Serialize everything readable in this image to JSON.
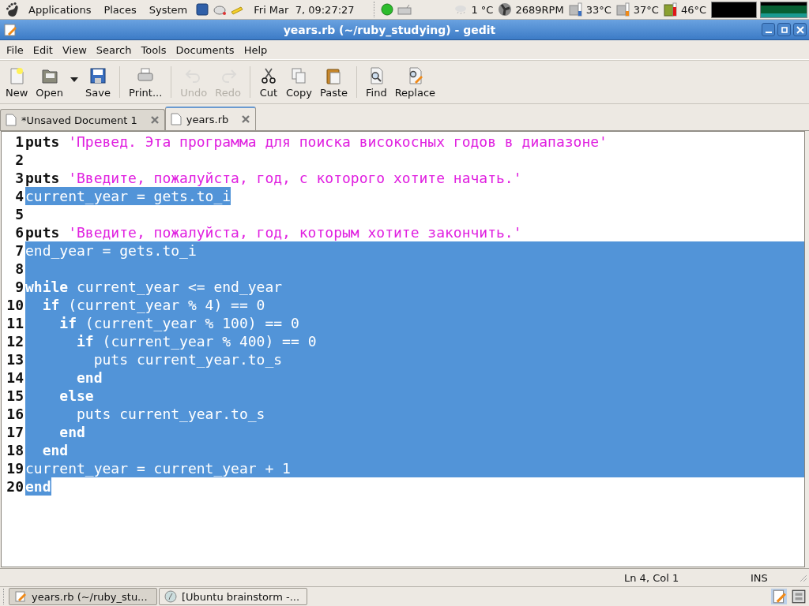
{
  "top_panel": {
    "menus": [
      "Applications",
      "Places",
      "System"
    ],
    "clock": "Fri Mar  7, 09:27:27",
    "sensors": [
      {
        "kind": "weather",
        "reading": "1 °C"
      },
      {
        "kind": "fan",
        "reading": "2689RPM"
      },
      {
        "kind": "thermo",
        "reading": "33°C",
        "color": "#3a6fc0"
      },
      {
        "kind": "thermo",
        "reading": "37°C",
        "color": "#f08a18"
      },
      {
        "kind": "card",
        "reading": "46°C",
        "color": "#e01818"
      }
    ]
  },
  "window": {
    "title": "years.rb (~/ruby_studying) - gedit"
  },
  "menu": [
    "File",
    "Edit",
    "View",
    "Search",
    "Tools",
    "Documents",
    "Help"
  ],
  "toolbar": [
    {
      "kind": "new",
      "label": "New",
      "disabled": false
    },
    {
      "kind": "open",
      "label": "Open",
      "disabled": false
    },
    {
      "kind": "dropdown"
    },
    {
      "kind": "save",
      "label": "Save",
      "disabled": false
    },
    {
      "kind": "separator"
    },
    {
      "kind": "print",
      "label": "Print...",
      "disabled": false
    },
    {
      "kind": "separator"
    },
    {
      "kind": "undo",
      "label": "Undo",
      "disabled": true
    },
    {
      "kind": "redo",
      "label": "Redo",
      "disabled": true
    },
    {
      "kind": "separator"
    },
    {
      "kind": "cut",
      "label": "Cut",
      "disabled": false
    },
    {
      "kind": "copy",
      "label": "Copy",
      "disabled": false
    },
    {
      "kind": "paste",
      "label": "Paste",
      "disabled": false
    },
    {
      "kind": "separator"
    },
    {
      "kind": "find",
      "label": "Find",
      "disabled": false
    },
    {
      "kind": "replace",
      "label": "Replace",
      "disabled": false
    }
  ],
  "tabs": [
    {
      "label": "*Unsaved Document 1",
      "selected": false
    },
    {
      "label": "years.rb",
      "selected": true
    }
  ],
  "editor": {
    "lines": [
      {
        "number": "1",
        "selected": false,
        "tokens": [
          {
            "kind": "keyword",
            "text": "puts "
          },
          {
            "kind": "string",
            "text": "'Превед. Эта программа для поиска високосных годов в диапазоне'"
          }
        ]
      },
      {
        "number": "2",
        "selected": false
      },
      {
        "number": "3",
        "selected": false,
        "tokens": [
          {
            "kind": "keyword",
            "text": "puts "
          },
          {
            "kind": "string",
            "text": "'Введите, пожалуйста, год, с которого хотите начать.'"
          }
        ]
      },
      {
        "number": "4",
        "selected": true,
        "tokens": [
          {
            "kind": "plain",
            "text": "current_year = gets.to_i"
          }
        ]
      },
      {
        "number": "5",
        "selected": false
      },
      {
        "number": "6",
        "selected": false,
        "tokens": [
          {
            "kind": "keyword",
            "text": "puts "
          },
          {
            "kind": "string",
            "text": "'Введите, пожалуйста, год, которым хотите закончить.'"
          }
        ]
      },
      {
        "number": "7",
        "selected": true,
        "tokens": [
          {
            "kind": "plain",
            "text": "end_year = gets.to_i"
          }
        ]
      },
      {
        "number": "8",
        "selected": true
      },
      {
        "number": "9",
        "selected": true,
        "tokens": [
          {
            "kind": "keyword",
            "text": "while"
          },
          {
            "kind": "plain",
            "text": " current_year <= end_year"
          }
        ]
      },
      {
        "number": "10",
        "selected": true,
        "tokens": [
          {
            "kind": "keyword",
            "text": "  if"
          },
          {
            "kind": "plain",
            "text": " (current_year % 4) == 0"
          }
        ]
      },
      {
        "number": "11",
        "selected": true,
        "tokens": [
          {
            "kind": "keyword",
            "text": "    if"
          },
          {
            "kind": "plain",
            "text": " (current_year % 100) == 0"
          }
        ]
      },
      {
        "number": "12",
        "selected": true,
        "tokens": [
          {
            "kind": "keyword",
            "text": "      if"
          },
          {
            "kind": "plain",
            "text": " (current_year % 400) == 0"
          }
        ]
      },
      {
        "number": "13",
        "selected": true,
        "tokens": [
          {
            "kind": "plain",
            "text": "        puts current_year.to_s"
          }
        ]
      },
      {
        "number": "14",
        "selected": true,
        "tokens": [
          {
            "kind": "keyword",
            "text": "      end"
          }
        ]
      },
      {
        "number": "15",
        "selected": true,
        "tokens": [
          {
            "kind": "keyword",
            "text": "    else"
          }
        ]
      },
      {
        "number": "16",
        "selected": true,
        "tokens": [
          {
            "kind": "plain",
            "text": "      puts current_year.to_s"
          }
        ]
      },
      {
        "number": "17",
        "selected": true,
        "tokens": [
          {
            "kind": "keyword",
            "text": "    end"
          }
        ]
      },
      {
        "number": "18",
        "selected": true,
        "tokens": [
          {
            "kind": "keyword",
            "text": "  end"
          }
        ]
      },
      {
        "number": "19",
        "selected": true,
        "tokens": [
          {
            "kind": "plain",
            "text": "current_year = current_year + 1"
          }
        ]
      },
      {
        "number": "20",
        "selected": true,
        "tokens": [
          {
            "kind": "keyword",
            "text": "end"
          }
        ]
      }
    ]
  },
  "status_bar": {
    "position": "Ln 4, Col 1",
    "mode": "INS"
  },
  "taskbar": {
    "windows": [
      {
        "label": "years.rb (~/ruby_stu...",
        "selected": true,
        "kind": "editor"
      },
      {
        "label": "[Ubuntu brainstorm -...",
        "selected": false,
        "kind": "browser"
      }
    ]
  }
}
